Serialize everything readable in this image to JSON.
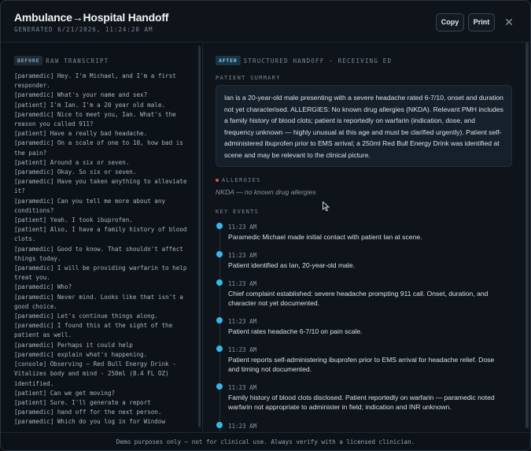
{
  "header": {
    "title": "Ambulance→Hospital Handoff",
    "generated": "GENERATED 6/21/2026, 11:24:20 AM",
    "copy_label": "Copy",
    "print_label": "Print",
    "close_glyph": "✕"
  },
  "before": {
    "tag": "BEFORE",
    "heading": "RAW TRANSCRIPT",
    "lines": [
      "[paramedic] Hey. I'm Michael, and I'm a first responder.",
      "[paramedic] What's your name and sex?",
      "[patient] I'm Ian. I'm a 20 year old male.",
      "[paramedic] Nice to meet you, Ian. What's the reason you called 911?",
      "[patient] Have a really bad headache.",
      "[paramedic] On a scale of one to 10, how bad is the pain?",
      "[patient] Around a six or seven.",
      "[paramedic] Okay. So six or seven.",
      "[paramedic] Have you taken anything to alleviate it?",
      "[paramedic] Can you tell me more about any conditions?",
      "[patient] Yeah. I took ibuprofen.",
      "[patient] Also, I have a family history of blood clots.",
      "[paramedic] Good to know. That shouldn't affect things today.",
      "[paramedic] I will be providing warfarin to help treat you.",
      "[paramedic] Who?",
      "[paramedic] Never mind. Looks like that isn't a good choice.",
      "[paramedic] Let's continue things along.",
      "[paramedic] I found this at the sight of the patient as well.",
      "[paramedic] Perhaps it could help",
      "[paramedic] explain what's happening.",
      "[console] Observing — Red Bull Energy Drink - Vitalizes body and mind - 250ml (8.4 FL OZ) identified.",
      "[patient] Can we get moving?",
      "[patient] Sure. I'll generate a report",
      "[paramedic] hand off for the next person.",
      "[paramedic] Which do you log in for Window"
    ]
  },
  "after": {
    "tag": "AFTER",
    "heading": "STRUCTURED HANDOFF · RECEIVING ED",
    "summary_label": "PATIENT SUMMARY",
    "summary": "Ian is a 20-year-old male presenting with a severe headache rated 6-7/10, onset and duration not yet characterised. ALLERGIES: No known drug allergies (NKDA). Relevant PMH includes a family history of blood clots; patient is reportedly on warfarin (indication, dose, and frequency unknown — highly unusual at this age and must be clarified urgently). Patient self-administered ibuprofen prior to EMS arrival; a 250ml Red Bull Energy Drink was identified at scene and may be relevant to the clinical picture.",
    "allergies_label": "ALLERGIES",
    "allergies": "NKDA — no known drug allergies",
    "events_label": "KEY EVENTS",
    "events": [
      {
        "time": "11:23 AM",
        "text": "Paramedic Michael made initial contact with patient Ian at scene."
      },
      {
        "time": "11:23 AM",
        "text": "Patient identified as Ian, 20-year-old male."
      },
      {
        "time": "11:23 AM",
        "text": "Chief complaint established: severe headache prompting 911 call. Onset, duration, and character not yet documented."
      },
      {
        "time": "11:23 AM",
        "text": "Patient rates headache 6-7/10 on pain scale."
      },
      {
        "time": "11:23 AM",
        "text": "Patient reports self-administering ibuprofen prior to EMS arrival for headache relief. Dose and timing not documented."
      },
      {
        "time": "11:23 AM",
        "text": "Family history of blood clots disclosed. Patient reportedly on warfarin — paramedic noted warfarin not appropriate to administer in field; indication and INR unknown."
      },
      {
        "time": "11:23 AM",
        "text": ""
      }
    ]
  },
  "footer": "Demo purposes only — not for clinical use. Always verify with a licensed clinician."
}
